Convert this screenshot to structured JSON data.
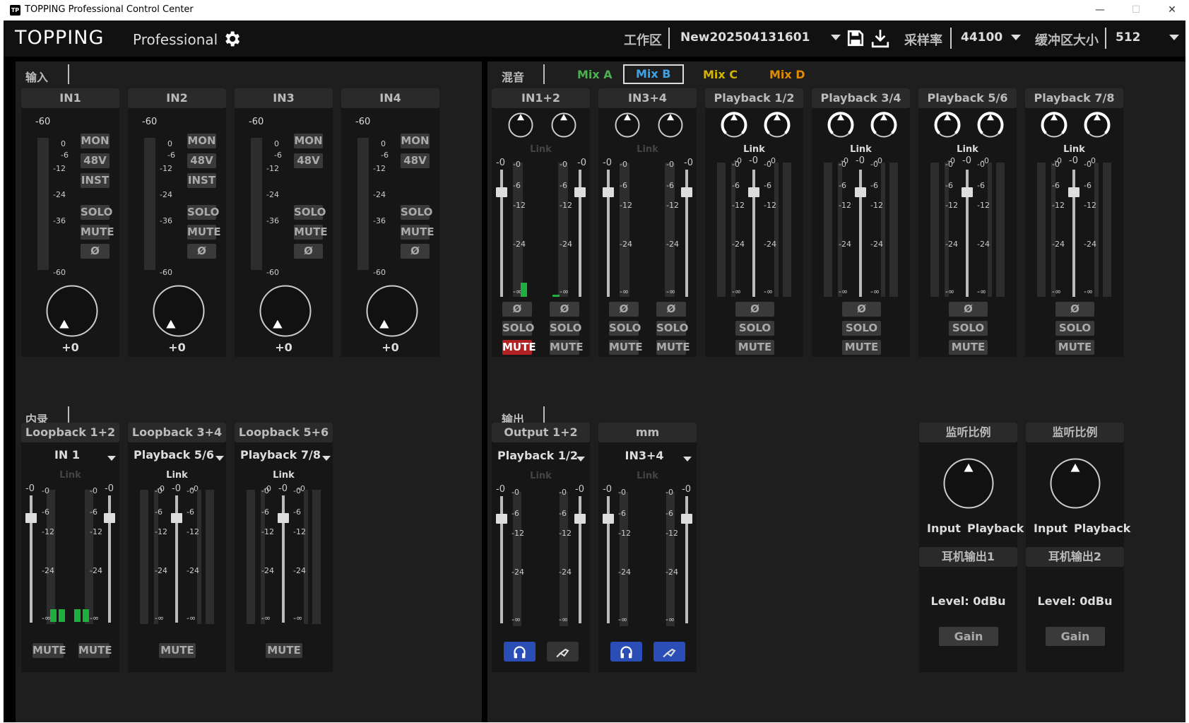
{
  "window": {
    "title": "TOPPING Professional Control Center",
    "logo_text": "TP"
  },
  "header": {
    "brand": "TOPPING",
    "brand_sub": "Professional",
    "workspace_label": "工作区",
    "workspace_value": "New202504131601",
    "samplerate_label": "采样率",
    "samplerate_value": "44100",
    "buffer_label": "缓冲区大小",
    "buffer_value": "512"
  },
  "input": {
    "title": "输入",
    "channels": [
      {
        "name": "IN1",
        "top": "-60",
        "gain": "+0",
        "buttons": [
          "MON",
          "48V",
          "INST"
        ]
      },
      {
        "name": "IN2",
        "top": "-60",
        "gain": "+0",
        "buttons": [
          "MON",
          "48V",
          "INST"
        ]
      },
      {
        "name": "IN3",
        "top": "-60",
        "gain": "+0",
        "buttons": [
          "MON",
          "48V"
        ]
      },
      {
        "name": "IN4",
        "top": "-60",
        "gain": "+0",
        "buttons": [
          "MON",
          "48V"
        ]
      }
    ],
    "solo": "SOLO",
    "mute": "MUTE",
    "phase": "Ø",
    "scale": [
      "0",
      "-6",
      "-12",
      "-24",
      "-36",
      "-60"
    ]
  },
  "mix": {
    "title": "混音",
    "tabs": [
      {
        "label": "Mix A",
        "color": "#4caf50",
        "active": false
      },
      {
        "label": "Mix B",
        "color": "#3da3e8",
        "active": true
      },
      {
        "label": "Mix C",
        "color": "#d4b400",
        "active": false
      },
      {
        "label": "Mix D",
        "color": "#e08a00",
        "active": false
      }
    ],
    "channels": [
      {
        "name": "IN1+2",
        "link": "Link",
        "linked": false
      },
      {
        "name": "IN3+4",
        "link": "Link",
        "linked": false
      },
      {
        "name": "Playback 1/2",
        "link": "Link",
        "linked": true
      },
      {
        "name": "Playback 3/4",
        "link": "Link",
        "linked": true
      },
      {
        "name": "Playback 5/6",
        "link": "Link",
        "linked": true
      },
      {
        "name": "Playback 7/8",
        "link": "Link",
        "linked": true
      }
    ],
    "fader_top": "-0",
    "scale": [
      "-0",
      "-6",
      "-12",
      "-24",
      "-∞"
    ],
    "phase": "Ø",
    "solo": "SOLO",
    "mute": "MUTE",
    "muted_channel": "IN1+2 L"
  },
  "loopback": {
    "title": "内录",
    "channels": [
      {
        "name": "Loopback 1+2",
        "source": "IN 1",
        "link": "Link",
        "linked": false
      },
      {
        "name": "Loopback 3+4",
        "source": "Playback 5/6",
        "link": "Link",
        "linked": true
      },
      {
        "name": "Loopback 5+6",
        "source": "Playback 7/8",
        "link": "Link",
        "linked": true
      }
    ],
    "mute": "MUTE"
  },
  "output": {
    "title": "输出",
    "channels": [
      {
        "name": "Output 1+2",
        "source": "Playback 1/2",
        "link": "Link"
      },
      {
        "name": "mm",
        "source": "IN3+4",
        "link": "Link"
      }
    ],
    "monitor": [
      {
        "title": "监听比例",
        "left": "Input",
        "right": "Playback",
        "out": "耳机输出1",
        "level": "Level:  0dBu",
        "gain": "Gain"
      },
      {
        "title": "监听比例",
        "left": "Input",
        "right": "Playback",
        "out": "耳机输出2",
        "level": "Level:  0dBu",
        "gain": "Gain"
      }
    ]
  }
}
